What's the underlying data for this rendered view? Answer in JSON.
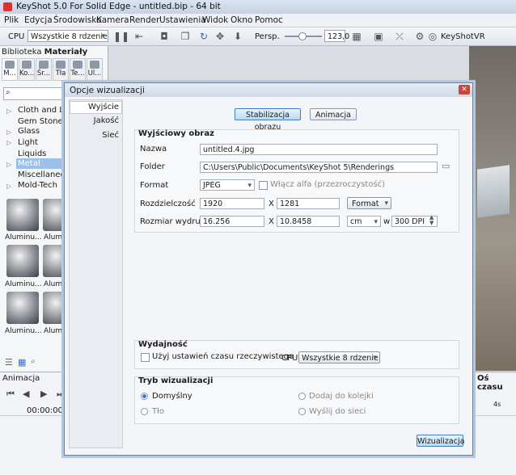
{
  "window": {
    "title": "KeyShot 5.0 For Solid Edge - untitled.bip - 64 bit"
  },
  "menu": [
    "Plik",
    "Edycja",
    "Środowisko",
    "Kamera",
    "Render",
    "Ustawienia",
    "Widok",
    "Okno",
    "Pomoc"
  ],
  "toolbar": {
    "cpu_label": "CPU",
    "cpu_select": "Wszystkie 8 rdzenie",
    "persp_label": "Persp.",
    "persp_value": "123,0",
    "keyshotvr": "KeyShotVR"
  },
  "library": {
    "title": "Biblioteka",
    "title_bold": "Materiały",
    "tabs": [
      "M...",
      "Ko...",
      "Śr...",
      "Tła",
      "Te...",
      "Ul..."
    ],
    "tree": [
      "Cloth and Le...",
      "Gem Stones",
      "Glass",
      "Light",
      "Liquids",
      "Metal",
      "Miscellaneo...",
      "Mold-Tech"
    ],
    "thumbs": [
      "Aluminu...",
      "Alumin",
      "Aluminu...",
      "Alumin",
      "Aluminu...",
      "Alumin"
    ]
  },
  "animation": {
    "title": "Animacja",
    "time_axis": "Oś czasu",
    "timecode": "00:00:000",
    "tick": "4s"
  },
  "dialog": {
    "title": "Opcje wizualizacji",
    "nav": [
      "Wyjście",
      "Jakość",
      "Sieć"
    ],
    "tab_stabilization": "Stabilizacja obrazu",
    "tab_animation": "Animacja",
    "output": {
      "heading": "Wyjściowy obraz",
      "name_label": "Nazwa",
      "name_value": "untitled.4.jpg",
      "folder_label": "Folder",
      "folder_value": "C:\\Users\\Public\\Documents\\KeyShot 5\\Renderings",
      "format_label": "Format",
      "format_value": "JPEG",
      "alpha_label": "Włącz alfa (przezroczystość)",
      "res_label": "Rozdzielczość",
      "res_w": "1920",
      "x1": "X",
      "res_h": "1281",
      "format_btn": "Format",
      "print_label": "Rozmiar wydruku",
      "print_w": "16.256",
      "x2": "X",
      "print_h": "10.8458",
      "unit": "cm",
      "w_label": "w",
      "dpi": "300 DPI"
    },
    "performance": {
      "heading": "Wydajność",
      "realtime_label": "Użyj ustawień czasu rzeczywistego",
      "cpu_label": "CPU",
      "cpu_value": "Wszystkie 8 rdzenie"
    },
    "mode": {
      "heading": "Tryb wizualizacji",
      "default": "Domyślny",
      "queue": "Dodaj do kolejki",
      "background": "Tło",
      "network": "Wyślij do sieci"
    },
    "render_button": "Wizualizacja"
  }
}
